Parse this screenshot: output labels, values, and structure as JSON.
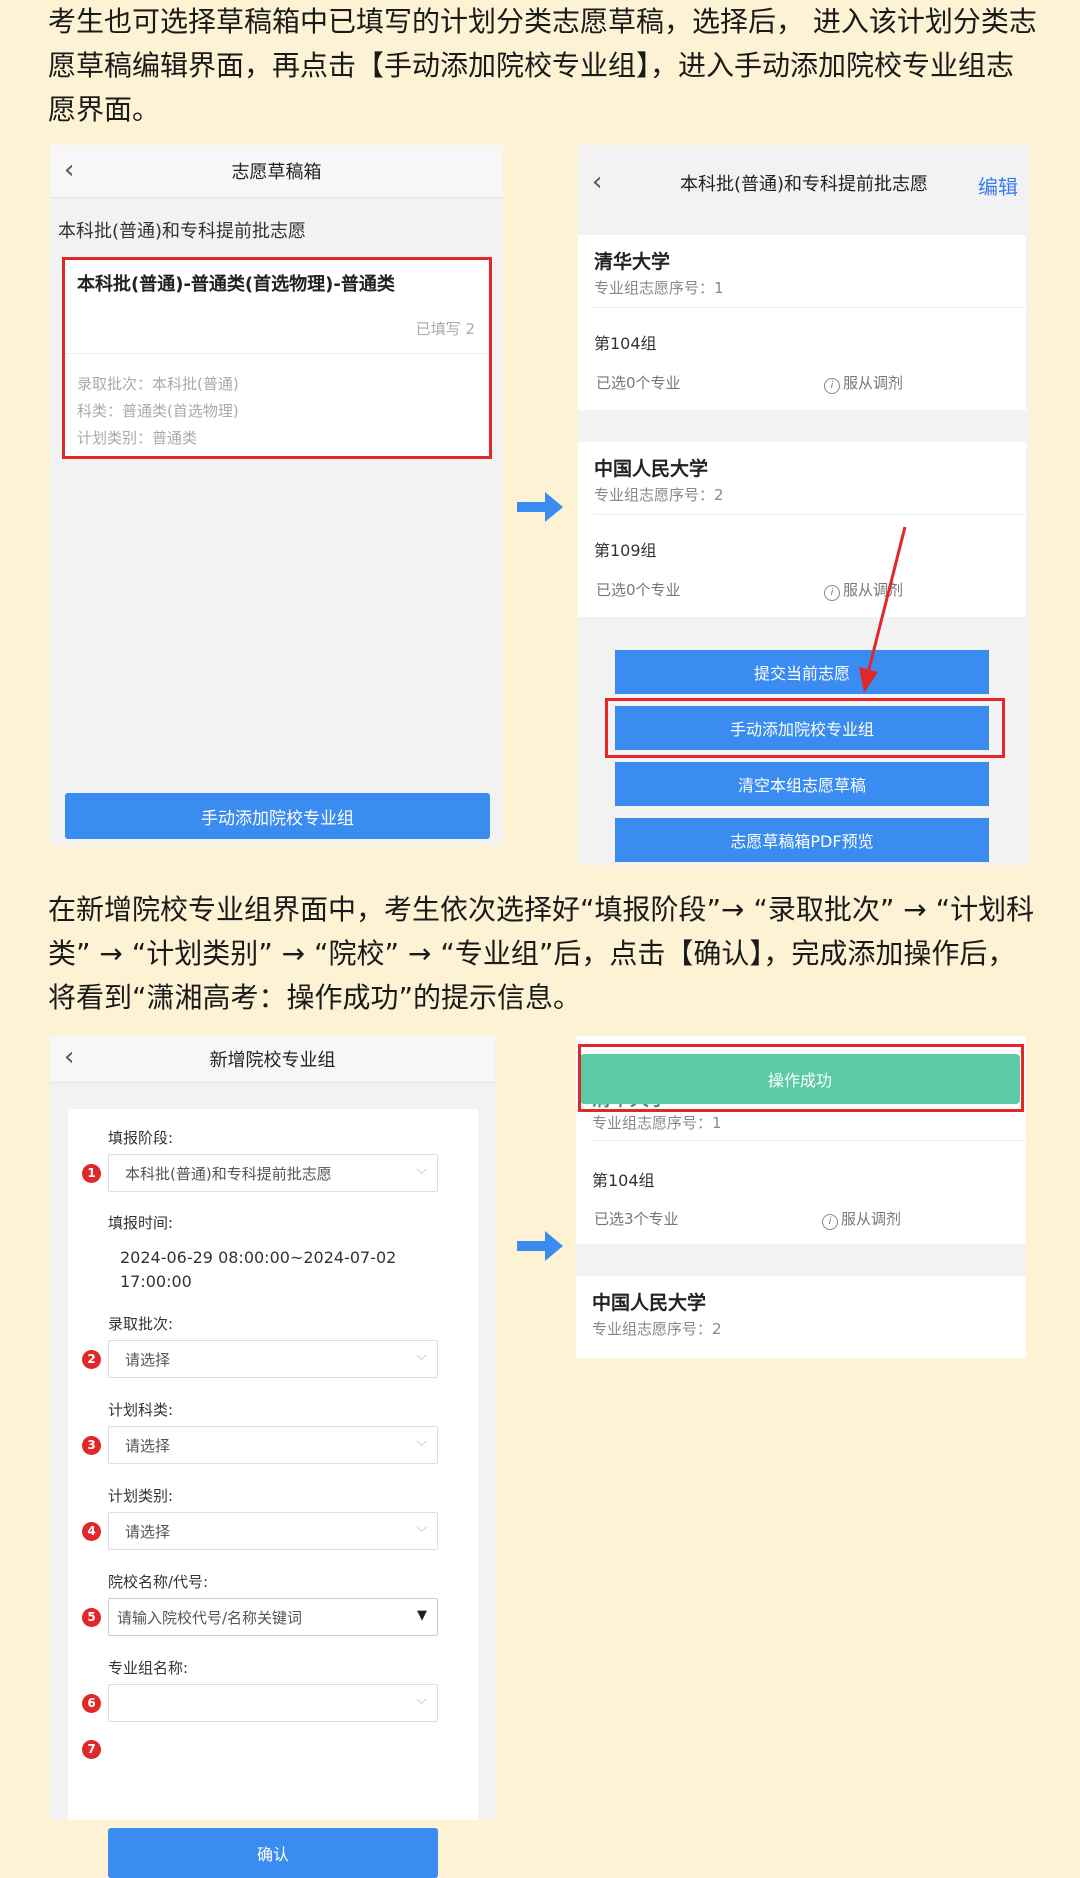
{
  "intro_paragraph": "考生也可选择草稿箱中已填写的计划分类志愿草稿，选择后， 进入该计划分类志愿草稿编辑界面，再点击【手动添加院校专业组】，进入手动添加院校专业组志愿界面。",
  "second_paragraph": "在新增院校专业组界面中，考生依次选择好“填报阶段”→ “录取批次” → “计划科类” → “计划类别” → “院校” → “专业组”后，点击【确认】，完成添加操作后，将看到“潇湘高考：操作成功”的提示信息。",
  "draft_box": {
    "title": "志愿草稿箱",
    "section": "本科批(普通)和专科提前批志愿",
    "card_title": "本科批(普通)-普通类(首选物理)-普通类",
    "filled": "已填写 2",
    "lines": [
      "录取批次：本科批(普通)",
      "科类：普通类(首选物理)",
      "计划类别：普通类"
    ],
    "add_button": "手动添加院校专业组"
  },
  "draft_edit": {
    "title": "本科批(普通)和专科提前批志愿",
    "edit": "编辑",
    "schools": [
      {
        "name": "清华大学",
        "order": "专业组志愿序号：1",
        "group": "第104组",
        "selected": "已选0个专业",
        "adjust": "服从调剂"
      },
      {
        "name": "中国人民大学",
        "order": "专业组志愿序号：2",
        "group": "第109组",
        "selected": "已选0个专业",
        "adjust": "服从调剂"
      }
    ],
    "buttons": [
      "提交当前志愿",
      "手动添加院校专业组",
      "清空本组志愿草稿",
      "志愿草稿箱PDF预览"
    ]
  },
  "add_group": {
    "title": "新增院校专业组",
    "stage_label": "填报阶段:",
    "stage_value": "本科批(普通)和专科提前批志愿",
    "time_label": "填报时间:",
    "time_line1": "2024-06-29 08:00:00~2024-07-02",
    "time_line2": "17:00:00",
    "batch_label": "录取批次:",
    "subject_label": "计划科类:",
    "category_label": "计划类别:",
    "college_label": "院校名称/代号:",
    "group_label": "专业组名称:",
    "placeholder_select": "请选择",
    "college_placeholder": "请输入院校代号/名称关键词",
    "confirm": "确认",
    "steps": [
      "1",
      "2",
      "3",
      "4",
      "5",
      "6",
      "7"
    ]
  },
  "result": {
    "toast": "操作成功",
    "schools": [
      {
        "name": "清华大学",
        "order": "专业组志愿序号：1",
        "group": "第104组",
        "selected": "已选3个专业",
        "adjust": "服从调剂"
      },
      {
        "name": "中国人民大学",
        "order": "专业组志愿序号：2"
      }
    ]
  },
  "colors": {
    "background": "#fdf2d3",
    "primary_button": "#3a8cf0",
    "highlight_frame": "#e02828",
    "toast": "#5cc9a7",
    "arrow": "#3a8cf0"
  }
}
